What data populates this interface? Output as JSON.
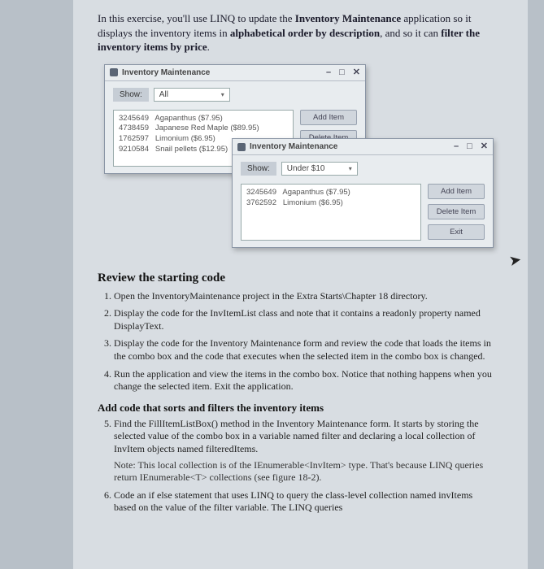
{
  "intro": {
    "line1a": "In this exercise, you'll use LINQ to update the ",
    "line1b": "Inventory Maintenance",
    "line1c": " application so it displays the inventory items in ",
    "line1d": "alphabetical order by description",
    "line1e": ", and so it can ",
    "line1f": "filter the inventory items by price",
    "line1g": "."
  },
  "winA": {
    "title": "Inventory Maintenance",
    "min": "–",
    "max": "□",
    "close": "✕",
    "showLabel": "Show:",
    "comboValue": "All",
    "items": [
      "3245649   Agapanthus ($7.95)",
      "4738459   Japanese Red Maple ($89.95)",
      "1762597   Limonium ($6.95)",
      "9210584   Snail pellets ($12.95)"
    ],
    "addBtn": "Add Item",
    "delBtn": "Delete Item"
  },
  "winB": {
    "title": "Inventory Maintenance",
    "min": "–",
    "max": "□",
    "close": "✕",
    "showLabel": "Show:",
    "comboValue": "Under $10",
    "items": [
      "3245649   Agapanthus ($7.95)",
      "3762592   Limonium ($6.95)"
    ],
    "addBtn": "Add Item",
    "delBtn": "Delete Item",
    "exitBtn": "Exit"
  },
  "review": {
    "h1": "Review the starting code",
    "s1a": "Open the InventoryMaintenance project in the Extra Starts\\Chapter 18 directory.",
    "s2a": "Display the code for the InvItemList class and note that it contains a readonly property named DisplayText.",
    "s3a": "Display the code for the Inventory Maintenance form and review the code that loads the items in the combo box and the code that executes when the selected item in the combo box is changed.",
    "s4a": "Run the application and view the items in the combo box. Notice that nothing happens when you change the selected item. Exit the application.",
    "h2": "Add code that sorts and filters the inventory items",
    "s5a": "Find the FillItemListBox() method in the Inventory Maintenance form. It starts by storing the selected value of the combo box in a variable named filter and declaring a local collection of InvItem objects named filteredItems.",
    "s5note": "Note: This local collection is of the IEnumerable<InvItem> type. That's because LINQ queries return IEnumerable<T> collections (see figure 18-2).",
    "s6a": "Code an if else statement that uses LINQ to query the class-level collection named invItems based on the value of the filter variable. The LINQ queries"
  }
}
